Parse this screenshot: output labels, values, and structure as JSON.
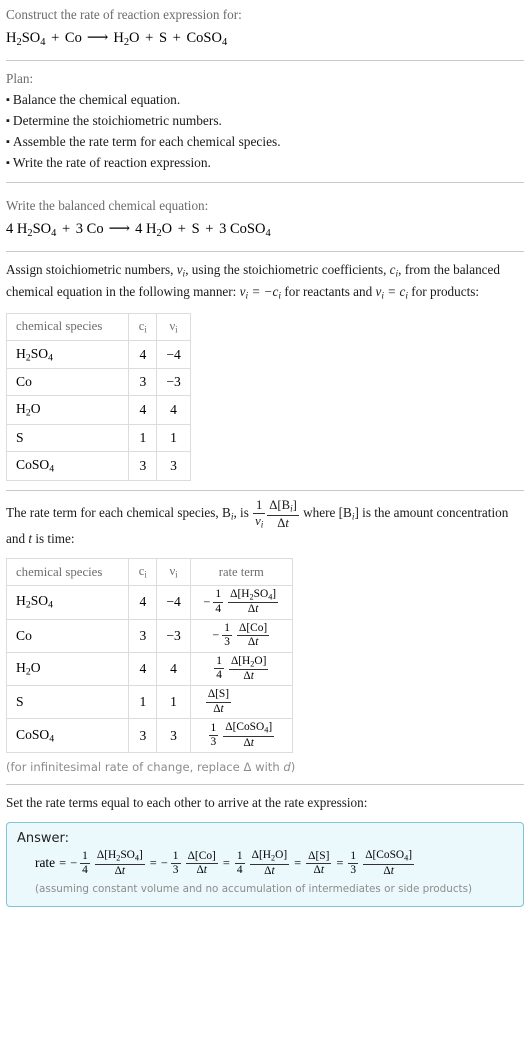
{
  "header": {
    "prompt": "Construct the rate of reaction expression for:",
    "equation": {
      "reactants": [
        {
          "formula": "H",
          "sub": "2",
          "formula2": "SO",
          "sub2": "4",
          "text": "H2SO4"
        },
        {
          "text": "Co"
        }
      ],
      "products": [
        {
          "text": "H2O"
        },
        {
          "text": "S"
        },
        {
          "text": "CoSO4"
        }
      ],
      "arrow": "⟶",
      "plus": "+"
    }
  },
  "plan": {
    "title": "Plan:",
    "items": [
      "Balance the chemical equation.",
      "Determine the stoichiometric numbers.",
      "Assemble the rate term for each chemical species.",
      "Write the rate of reaction expression."
    ]
  },
  "balanced": {
    "title": "Write the balanced chemical equation:",
    "coefficients": {
      "h2so4": "4",
      "co": "3",
      "h2o": "4",
      "s": "",
      "coso4": "3"
    }
  },
  "assign": {
    "text_part1": "Assign stoichiometric numbers, ",
    "nu_i": "νi",
    "text_part2": ", using the stoichiometric coefficients, ",
    "c_i": "ci",
    "text_part3": ", from the balanced chemical equation in the following manner: ",
    "rule_reactants": "νi = −ci",
    "text_part4": " for reactants and ",
    "rule_products": "νi = ci",
    "text_part5": " for products:"
  },
  "table1": {
    "headers": [
      "chemical species",
      "ci",
      "νi"
    ],
    "rows": [
      {
        "species": "H2SO4",
        "c": "4",
        "nu": "−4"
      },
      {
        "species": "Co",
        "c": "3",
        "nu": "−3"
      },
      {
        "species": "H2O",
        "c": "4",
        "nu": "4"
      },
      {
        "species": "S",
        "c": "1",
        "nu": "1"
      },
      {
        "species": "CoSO4",
        "c": "3",
        "nu": "3"
      }
    ]
  },
  "rateterm_intro": {
    "part1": "The rate term for each chemical species, B",
    "sub1": "i",
    "part2": ", is ",
    "frac_num": "1",
    "frac_den": "νi",
    "frac2_num": "Δ[Bi]",
    "frac2_den": "Δt",
    "part3": " where [B",
    "sub2": "i",
    "part4": "] is the amount concentration and ",
    "t_italic": "t",
    "part5": " is time:"
  },
  "table2": {
    "headers": [
      "chemical species",
      "ci",
      "νi",
      "rate term"
    ],
    "rows": [
      {
        "species": "H2SO4",
        "c": "4",
        "nu": "−4",
        "sign": "−",
        "coef_num": "1",
        "coef_den": "4",
        "delta_num": "Δ[H2SO4]",
        "delta_den": "Δt",
        "has_coef": true
      },
      {
        "species": "Co",
        "c": "3",
        "nu": "−3",
        "sign": "−",
        "coef_num": "1",
        "coef_den": "3",
        "delta_num": "Δ[Co]",
        "delta_den": "Δt",
        "has_coef": true
      },
      {
        "species": "H2O",
        "c": "4",
        "nu": "4",
        "sign": "",
        "coef_num": "1",
        "coef_den": "4",
        "delta_num": "Δ[H2O]",
        "delta_den": "Δt",
        "has_coef": true
      },
      {
        "species": "S",
        "c": "1",
        "nu": "1",
        "sign": "",
        "coef_num": "",
        "coef_den": "",
        "delta_num": "Δ[S]",
        "delta_den": "Δt",
        "has_coef": false
      },
      {
        "species": "CoSO4",
        "c": "3",
        "nu": "3",
        "sign": "",
        "coef_num": "1",
        "coef_den": "3",
        "delta_num": "Δ[CoSO4]",
        "delta_den": "Δt",
        "has_coef": true
      }
    ],
    "footnote": "(for infinitesimal rate of change, replace Δ with d)"
  },
  "final": {
    "intro": "Set the rate terms equal to each other to arrive at the rate expression:"
  },
  "answer": {
    "label": "Answer:",
    "rate_word": "rate",
    "equals": "=",
    "terms": [
      {
        "sign": "−",
        "coef_num": "1",
        "coef_den": "4",
        "delta_num": "Δ[H2SO4]",
        "delta_den": "Δt",
        "has_coef": true
      },
      {
        "sign": "−",
        "coef_num": "1",
        "coef_den": "3",
        "delta_num": "Δ[Co]",
        "delta_den": "Δt",
        "has_coef": true
      },
      {
        "sign": "",
        "coef_num": "1",
        "coef_den": "4",
        "delta_num": "Δ[H2O]",
        "delta_den": "Δt",
        "has_coef": true
      },
      {
        "sign": "",
        "coef_num": "",
        "coef_den": "",
        "delta_num": "Δ[S]",
        "delta_den": "Δt",
        "has_coef": false
      },
      {
        "sign": "",
        "coef_num": "1",
        "coef_den": "3",
        "delta_num": "Δ[CoSO4]",
        "delta_den": "Δt",
        "has_coef": true
      }
    ],
    "note": "(assuming constant volume and no accumulation of intermediates or side products)"
  },
  "colors": {
    "answer_border": "#7fc4cf",
    "answer_bg": "#ebf9fc",
    "divider": "#c8c8c8",
    "label_gray": "#6b6b6b",
    "table_border": "#dcdcdc"
  }
}
